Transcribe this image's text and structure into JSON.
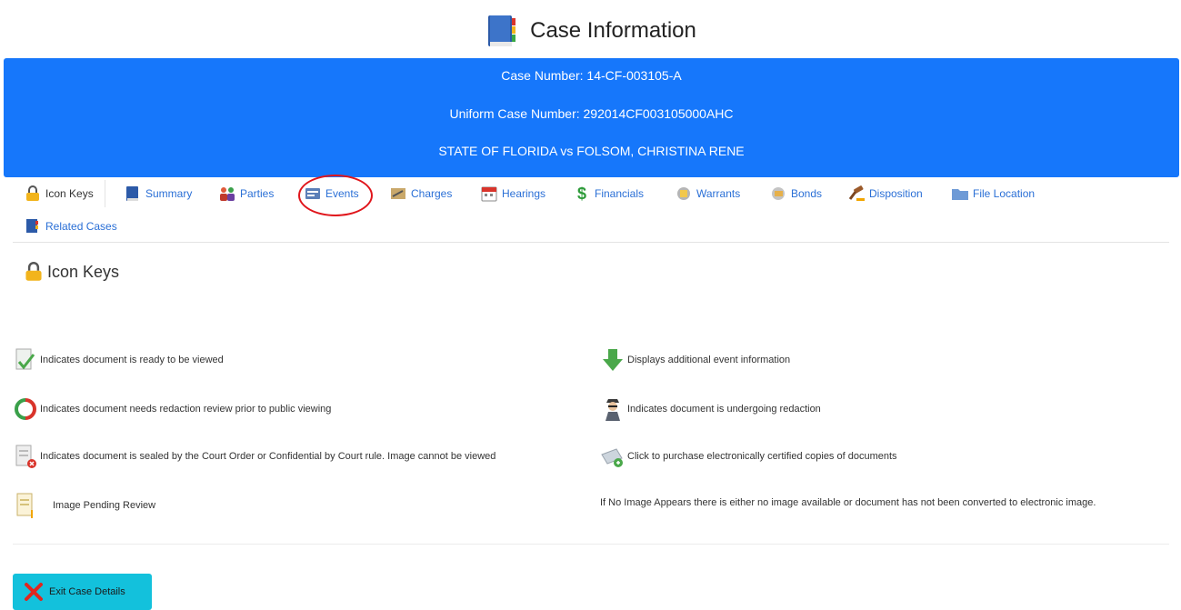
{
  "page": {
    "title": "Case Information"
  },
  "banner": {
    "case_number": "Case Number: 14-CF-003105-A",
    "uniform_case_number": "Uniform Case Number: 292014CF003105000AHC",
    "case_style": "STATE OF FLORIDA vs FOLSOM, CHRISTINA RENE",
    "color": "#1677fb"
  },
  "tabs": [
    {
      "label": "Icon Keys",
      "icon": "lock-icon",
      "active": true
    },
    {
      "label": "Summary",
      "icon": "book-icon"
    },
    {
      "label": "Parties",
      "icon": "people-icon"
    },
    {
      "label": "Events",
      "icon": "events-icon",
      "highlighted": true
    },
    {
      "label": "Charges",
      "icon": "charges-icon"
    },
    {
      "label": "Hearings",
      "icon": "calendar-icon"
    },
    {
      "label": "Financials",
      "icon": "dollar-icon"
    },
    {
      "label": "Warrants",
      "icon": "warrant-icon"
    },
    {
      "label": "Bonds",
      "icon": "bond-icon"
    },
    {
      "label": "Disposition",
      "icon": "gavel-icon"
    },
    {
      "label": "File Location",
      "icon": "folder-icon"
    },
    {
      "label": "Related Cases",
      "icon": "related-cases-icon"
    }
  ],
  "section": {
    "title": "Icon Keys"
  },
  "icon_keys": {
    "left": [
      {
        "icon": "document-ready-icon",
        "text": "Indicates document is ready to be viewed"
      },
      {
        "icon": "redaction-review-icon",
        "text": "Indicates document needs redaction review prior to public viewing"
      },
      {
        "icon": "document-sealed-icon",
        "text": "Indicates document is sealed by the Court Order or Confidential by Court rule. Image cannot be viewed"
      },
      {
        "icon": "image-pending-icon",
        "text": "Image Pending Review"
      }
    ],
    "right": [
      {
        "icon": "down-arrow-icon",
        "text": "Displays additional event information"
      },
      {
        "icon": "redaction-agent-icon",
        "text": "Indicates document is undergoing redaction"
      },
      {
        "icon": "certified-copies-icon",
        "text": "Click to purchase electronically certified copies of documents"
      }
    ],
    "note": "If No Image Appears there is either no image available or document has not been converted to electronic image."
  },
  "exit_button": {
    "label": "Exit Case Details",
    "icon": "close-x-icon",
    "color": "#13c1dc"
  }
}
